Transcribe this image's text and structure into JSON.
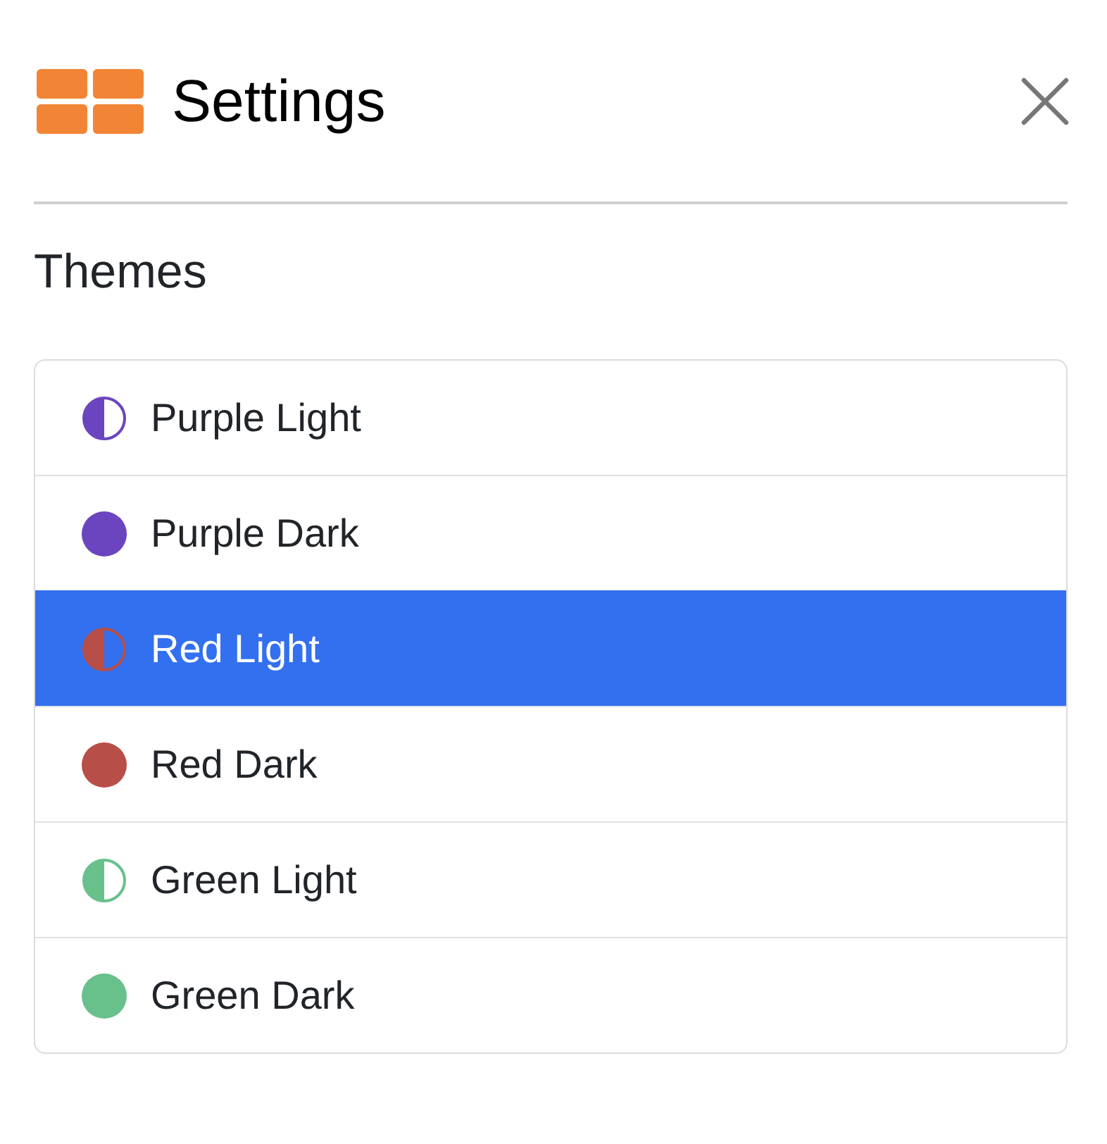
{
  "header": {
    "title": "Settings"
  },
  "section": {
    "title": "Themes"
  },
  "themes": [
    {
      "label": "Purple Light",
      "kind": "light",
      "color": "#6b45bf",
      "selected": false
    },
    {
      "label": "Purple Dark",
      "kind": "dark",
      "color": "#6b45bf",
      "selected": false
    },
    {
      "label": "Red Light",
      "kind": "light",
      "color": "#b74f48",
      "selected": true
    },
    {
      "label": "Red Dark",
      "kind": "dark",
      "color": "#b74f48",
      "selected": false
    },
    {
      "label": "Green Light",
      "kind": "light",
      "color": "#68c08b",
      "selected": false
    },
    {
      "label": "Green Dark",
      "kind": "dark",
      "color": "#68c08b",
      "selected": false
    }
  ]
}
